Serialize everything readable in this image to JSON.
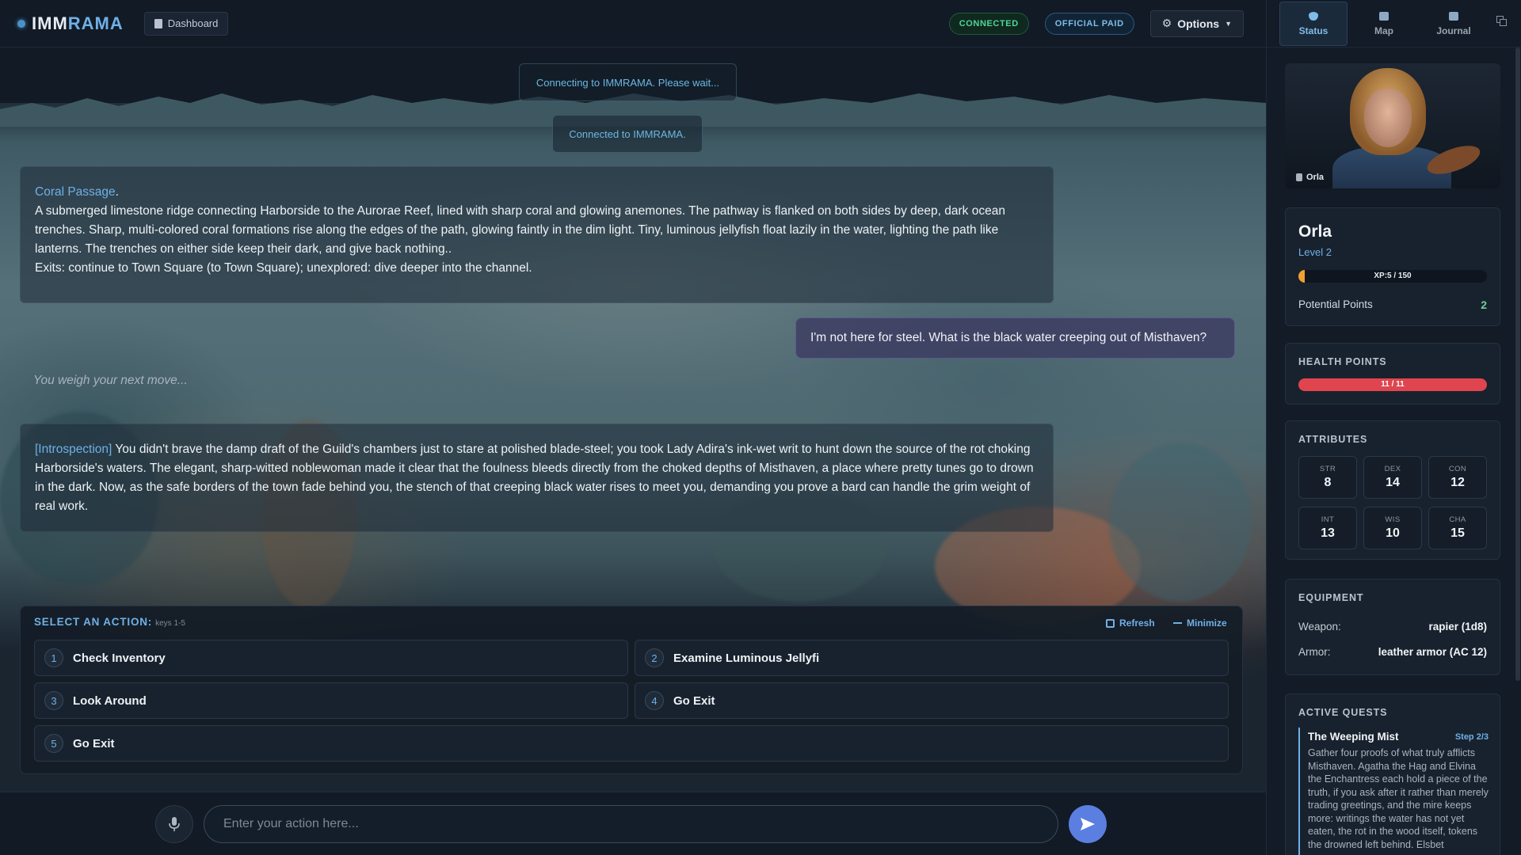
{
  "app": {
    "brand_prefix": "IMM",
    "brand_suffix": "RAMA",
    "dashboard_label": "Dashboard",
    "status_connected": "CONNECTED",
    "status_paid": "OFFICIAL PAID",
    "options_label": "Options"
  },
  "system_messages": [
    "Connecting to IMMRAMA. Please wait...",
    "Connected to IMMRAMA."
  ],
  "narrative": {
    "location_name": "Coral Passage",
    "location_suffix": ".",
    "location_description": "A submerged limestone ridge connecting Harborside to the Aurorae Reef, lined with sharp coral and glowing anemones. The pathway is flanked on both sides by deep, dark ocean trenches. Sharp, multi-colored coral formations rise along the edges of the path, glowing faintly in the dim light. Tiny, luminous jellyfish float lazily in the water, lighting the path like lanterns. The trenches on either side keep their dark, and give back nothing..",
    "exits": "Exits: continue to Town Square (to Town Square); unexplored: dive deeper into the channel.",
    "player_message": "I'm not here for steel. What is the black water creeping out of Misthaven?",
    "thinking": "You weigh your next move...",
    "introspection_tag": "[Introspection]",
    "introspection_text": " You didn't brave the damp draft of the Guild's chambers just to stare at polished blade-steel; you took Lady Adira's ink-wet writ to hunt down the source of the rot choking Harborside's waters. The elegant, sharp-witted noblewoman made it clear that the foulness bleeds directly from the choked depths of Misthaven, a place where pretty tunes go to drown in the dark. Now, as the safe borders of the town fade behind you, the stench of that creeping black water rises to meet you, demanding you prove a bard can handle the grim weight of real work."
  },
  "actions": {
    "title": "SELECT AN ACTION:",
    "keys_hint": "keys 1-5",
    "refresh_label": "Refresh",
    "minimize_label": "Minimize",
    "items": [
      {
        "num": "1",
        "label": "Check Inventory"
      },
      {
        "num": "2",
        "label": "Examine Luminous Jellyfi"
      },
      {
        "num": "3",
        "label": "Look Around"
      },
      {
        "num": "4",
        "label": "Go Exit"
      },
      {
        "num": "5",
        "label": "Go Exit"
      }
    ]
  },
  "input": {
    "placeholder": "Enter your action here..."
  },
  "side": {
    "tabs": [
      {
        "label": "Status",
        "icon": "shield-icon"
      },
      {
        "label": "Map",
        "icon": "map-icon"
      },
      {
        "label": "Journal",
        "icon": "book-icon"
      }
    ],
    "portrait_name": "Orla",
    "character": {
      "name": "Orla",
      "level": "Level 2",
      "xp_text": "XP:5 / 150",
      "xp_fraction": 0.033,
      "potential_label": "Potential Points",
      "potential_value": "2"
    },
    "health": {
      "title": "HEALTH POINTS",
      "text": "11 / 11",
      "fraction": 1.0
    },
    "attributes": {
      "title": "ATTRIBUTES",
      "items": [
        {
          "label": "STR",
          "value": "8"
        },
        {
          "label": "DEX",
          "value": "14"
        },
        {
          "label": "CON",
          "value": "12"
        },
        {
          "label": "INT",
          "value": "13"
        },
        {
          "label": "WIS",
          "value": "10"
        },
        {
          "label": "CHA",
          "value": "15"
        }
      ]
    },
    "equipment": {
      "title": "EQUIPMENT",
      "weapon_label": "Weapon:",
      "weapon_value": "rapier (1d8)",
      "armor_label": "Armor:",
      "armor_value": "leather armor (AC 12)"
    },
    "quests": {
      "title": "ACTIVE QUESTS",
      "items": [
        {
          "name": "The Weeping Mist",
          "step": "Step 2/3",
          "description": "Gather four proofs of what truly afflicts Misthaven. Agatha the Hag and Elvina the Enchantress each hold a piece of the truth, if you ask after it rather than merely trading greetings, and the mire keeps more: writings the water has not yet eaten, the rot in the wood itself, tokens the drowned left behind. Elsbet"
        }
      ]
    }
  },
  "colors": {
    "accent": "#6fb0e8",
    "connected": "#4fd59a",
    "hp": "#e0454f",
    "xp": "#f0a030",
    "send": "#5a7fe0"
  }
}
